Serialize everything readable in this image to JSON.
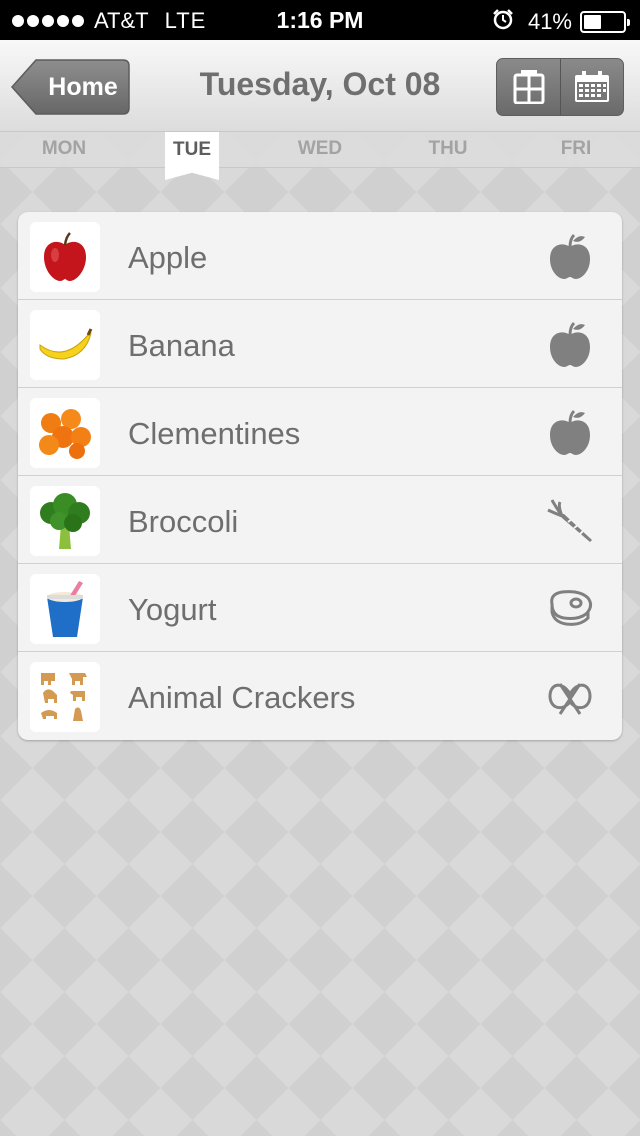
{
  "status_bar": {
    "carrier": "AT&T",
    "network": "LTE",
    "time": "1:16 PM",
    "battery_text": "41%",
    "battery_level": 0.41,
    "signal_dots": 5
  },
  "nav": {
    "back_label": "Home",
    "title": "Tuesday, Oct 08",
    "views": [
      "grid-view-icon",
      "calendar-icon"
    ]
  },
  "days": [
    {
      "label": "MON",
      "active": false
    },
    {
      "label": "TUE",
      "active": true
    },
    {
      "label": "WED",
      "active": false
    },
    {
      "label": "THU",
      "active": false
    },
    {
      "label": "FRI",
      "active": false
    }
  ],
  "foods": [
    {
      "name": "Apple",
      "image": "apple",
      "group_icon": "fruit-icon"
    },
    {
      "name": "Banana",
      "image": "banana",
      "group_icon": "fruit-icon"
    },
    {
      "name": "Clementines",
      "image": "clementines",
      "group_icon": "fruit-icon"
    },
    {
      "name": "Broccoli",
      "image": "broccoli",
      "group_icon": "vegetable-icon"
    },
    {
      "name": "Yogurt",
      "image": "yogurt",
      "group_icon": "protein-icon"
    },
    {
      "name": "Animal Crackers",
      "image": "animal-crackers",
      "group_icon": "grain-icon"
    }
  ],
  "colors": {
    "accent_gray": "#7a7a7a",
    "text_gray": "#6e6e6e",
    "status_bar": "#000000"
  }
}
